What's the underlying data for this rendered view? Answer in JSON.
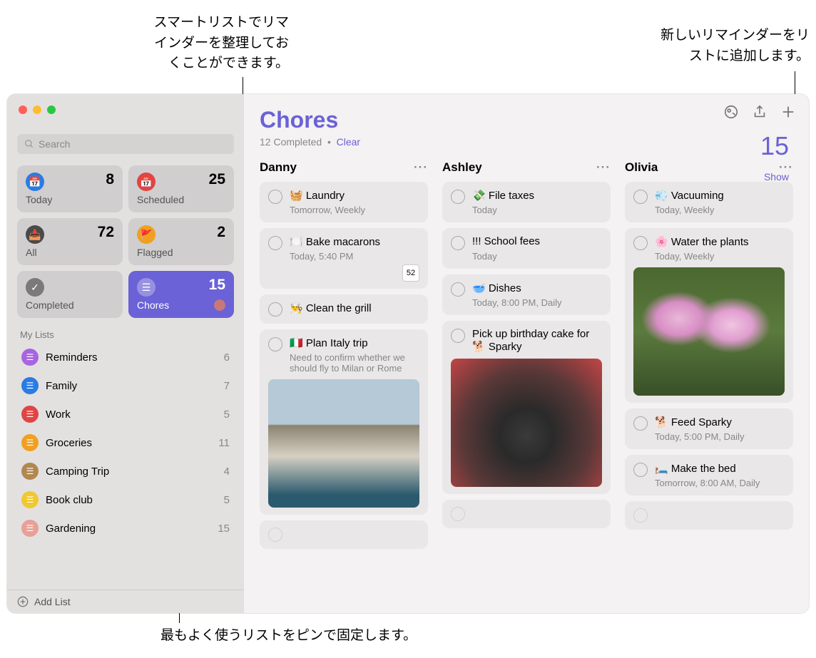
{
  "callouts": {
    "smart_lists": "スマートリストでリマ\nインダーを整理してお\nくことができます。",
    "add_reminder": "新しいリマインダーをリ\nストに追加します。",
    "pin_lists": "最もよく使うリストをピンで固定します。"
  },
  "sidebar": {
    "search_placeholder": "Search",
    "smart_tiles": [
      {
        "label": "Today",
        "count": 8,
        "icon": "calendar",
        "color": "#2a7be4"
      },
      {
        "label": "Scheduled",
        "count": 25,
        "icon": "calendar",
        "color": "#e04545"
      },
      {
        "label": "All",
        "count": 72,
        "icon": "inbox",
        "color": "#4a4a4a"
      },
      {
        "label": "Flagged",
        "count": 2,
        "icon": "flag",
        "color": "#f0a020"
      },
      {
        "label": "Completed",
        "count": "",
        "icon": "check",
        "color": "#7a7a7a"
      },
      {
        "label": "Chores",
        "count": 15,
        "icon": "list",
        "color": "#fff",
        "active": true
      }
    ],
    "my_lists_label": "My Lists",
    "lists": [
      {
        "label": "Reminders",
        "count": 6,
        "color": "#a865e0"
      },
      {
        "label": "Family",
        "count": 7,
        "color": "#2a7be4"
      },
      {
        "label": "Work",
        "count": 5,
        "color": "#e04545"
      },
      {
        "label": "Groceries",
        "count": 11,
        "color": "#f0a020"
      },
      {
        "label": "Camping Trip",
        "count": 4,
        "color": "#b08850"
      },
      {
        "label": "Book club",
        "count": 5,
        "color": "#f0c830"
      },
      {
        "label": "Gardening",
        "count": 15,
        "color": "#e8a098"
      }
    ],
    "add_list_label": "Add List"
  },
  "main": {
    "title": "Chores",
    "count": 15,
    "completed_text": "12 Completed",
    "clear_label": "Clear",
    "show_label": "Show",
    "columns": [
      {
        "name": "Danny",
        "items": [
          {
            "title": "🧺 Laundry",
            "sub": "Tomorrow, Weekly"
          },
          {
            "title": "🍽️ Bake macarons",
            "sub": "Today, 5:40 PM",
            "week": "52"
          },
          {
            "title": "👨‍🍳 Clean the grill"
          },
          {
            "title": "🇮🇹 Plan Italy trip",
            "sub": "Need to confirm whether we should fly to Milan or Rome",
            "img": "italy"
          }
        ]
      },
      {
        "name": "Ashley",
        "items": [
          {
            "title": "💸 File taxes",
            "sub": "Today"
          },
          {
            "title": "!!! School fees",
            "sub": "Today"
          },
          {
            "title": "🥣 Dishes",
            "sub": "Today, 8:00 PM, Daily"
          },
          {
            "title": "Pick up birthday cake for 🐕 Sparky",
            "img": "dog"
          }
        ]
      },
      {
        "name": "Olivia",
        "items": [
          {
            "title": "💨 Vacuuming",
            "sub": "Today, Weekly"
          },
          {
            "title": "🌸 Water the plants",
            "sub": "Today, Weekly",
            "img": "flowers"
          },
          {
            "title": "🐕 Feed Sparky",
            "sub": "Today, 5:00 PM, Daily"
          },
          {
            "title": "🛏️ Make the bed",
            "sub": "Tomorrow, 8:00 AM, Daily"
          }
        ]
      }
    ]
  }
}
